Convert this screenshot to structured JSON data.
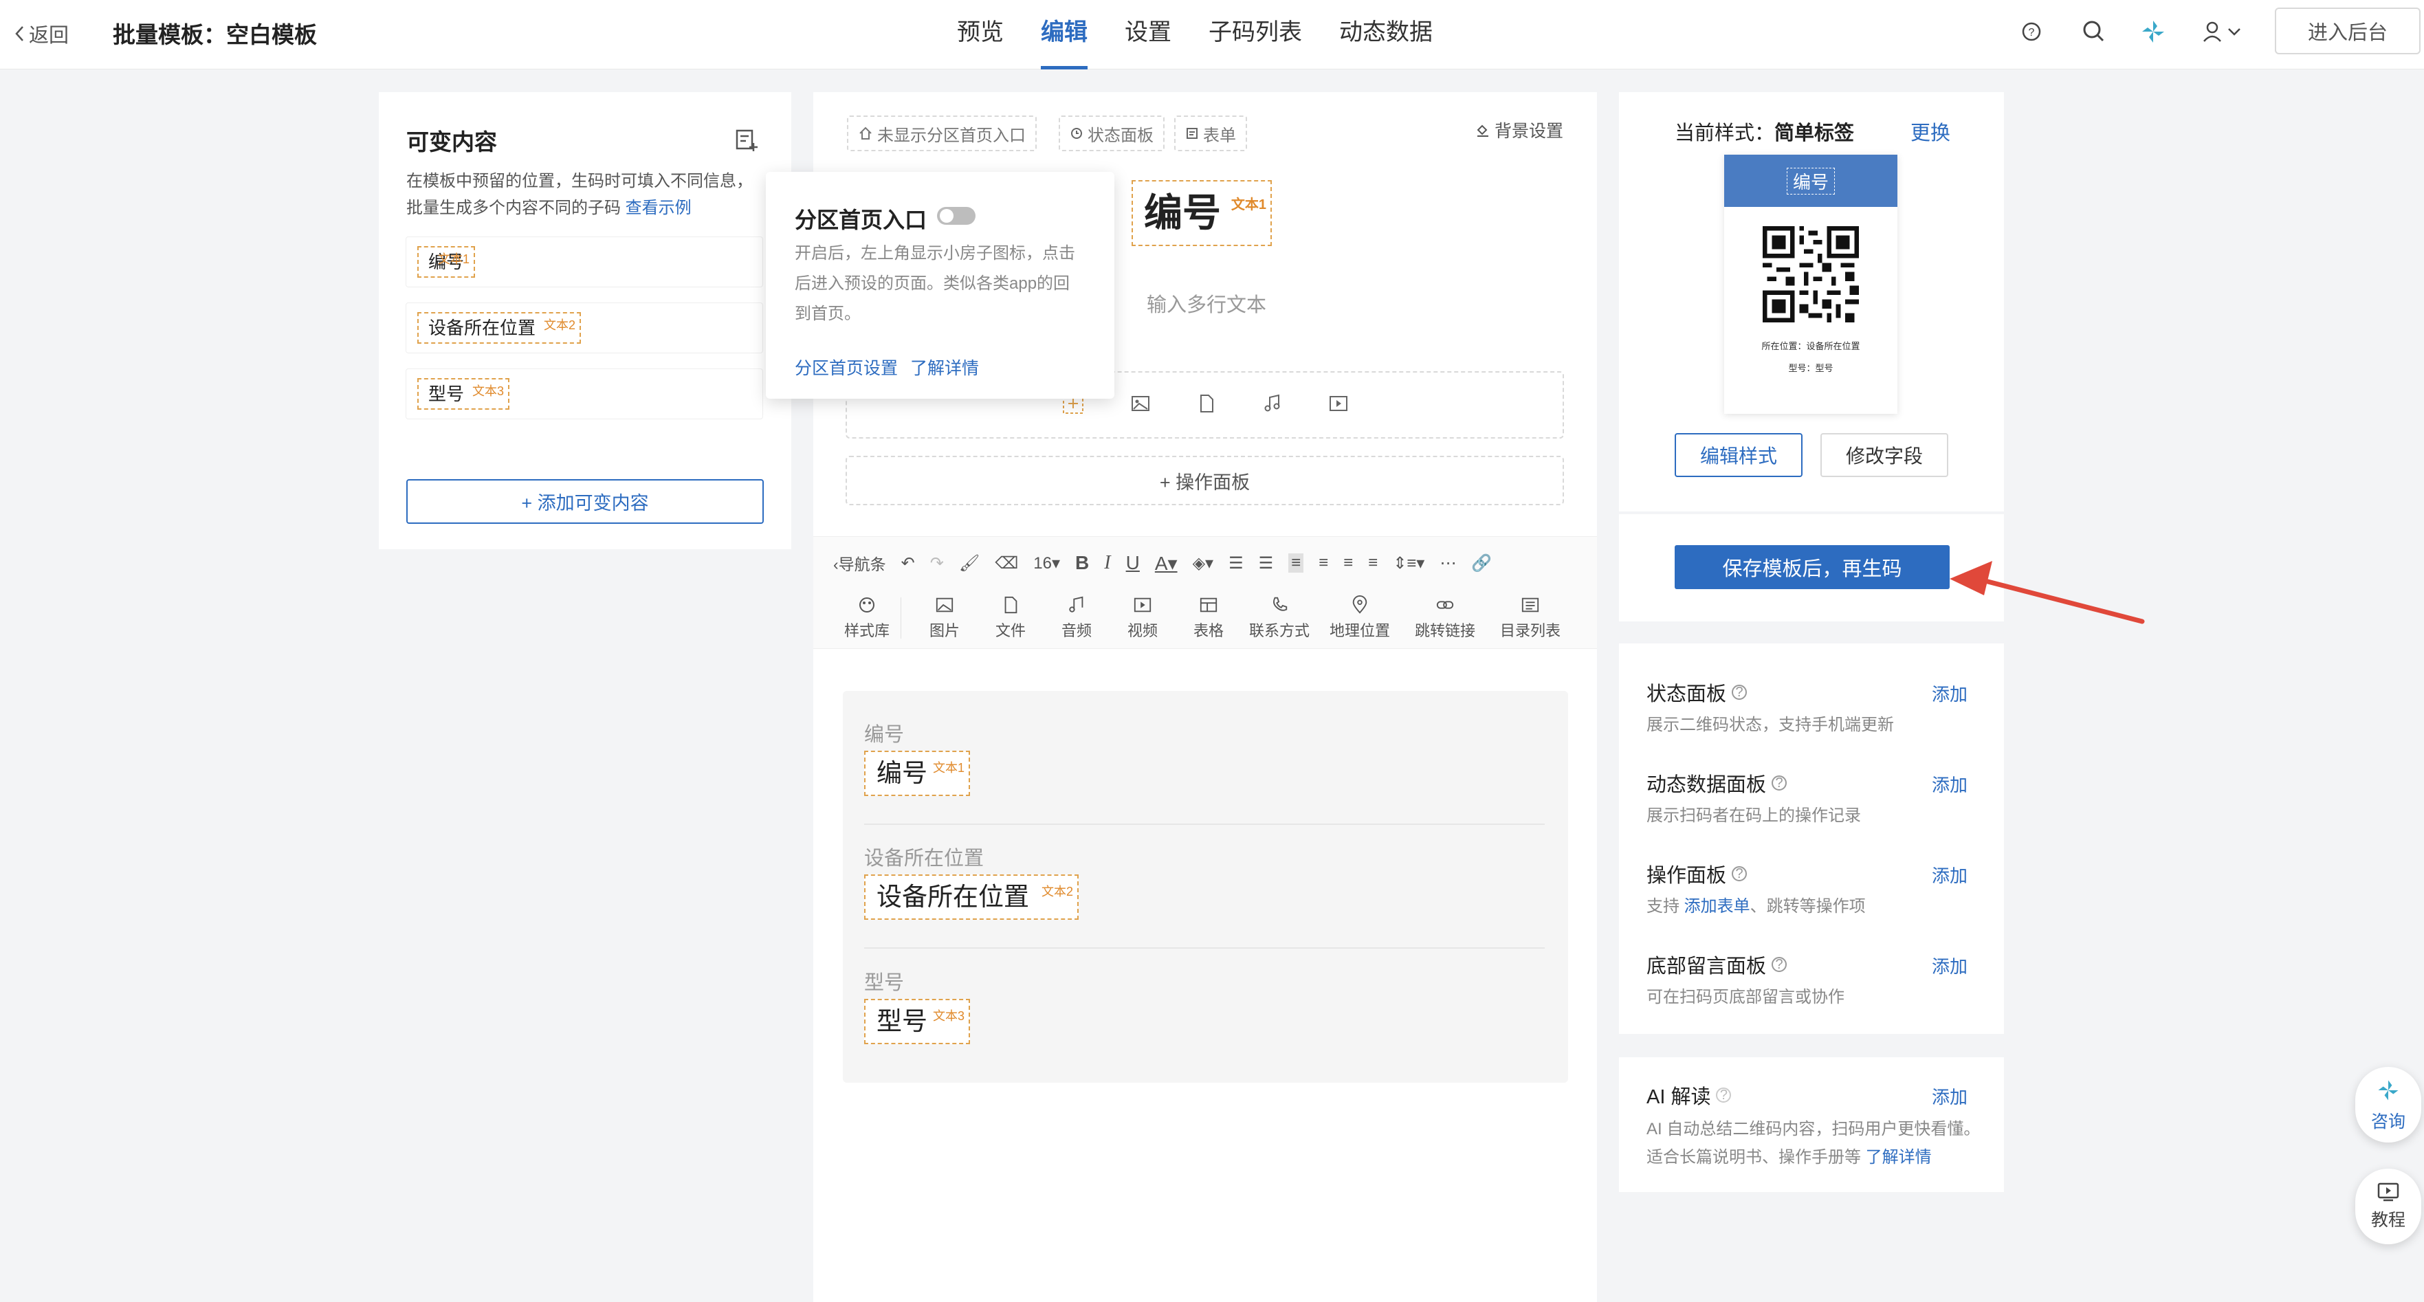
{
  "header": {
    "back_label": "返回",
    "title": "批量模板：空白模板",
    "tabs": [
      {
        "label": "预览"
      },
      {
        "label": "编辑"
      },
      {
        "label": "设置"
      },
      {
        "label": "子码列表"
      },
      {
        "label": "动态数据"
      }
    ],
    "active_tab": "编辑",
    "enter_backend": "进入后台"
  },
  "left_panel": {
    "title": "可变内容",
    "desc": "在模板中预留的位置，生码时可填入不同信息，批量生成多个内容不同的子码",
    "example_link": "查看示例",
    "items": [
      {
        "label": "编号",
        "tag": "文本1"
      },
      {
        "label": "设备所在位置",
        "tag": "文本2"
      },
      {
        "label": "型号",
        "tag": "文本3"
      }
    ],
    "add_button": "+ 添加可变内容"
  },
  "editor": {
    "home_entry_chip": "未显示分区首页入口",
    "status_panel_chip": "状态面板",
    "form_chip": "表单",
    "bg_settings": "背景设置",
    "heading_tag": {
      "label": "编号",
      "tag": "文本1"
    },
    "multiline_placeholder": "输入多行文本",
    "ops_panel": "+ 操作面板",
    "toolbar": {
      "nav_label": "导航条",
      "font_size": "16",
      "style_lib": "样式库",
      "inserts": [
        "图片",
        "文件",
        "音频",
        "视频",
        "表格",
        "联系方式",
        "地理位置",
        "跳转链接",
        "目录列表"
      ]
    },
    "fields": [
      {
        "label": "编号",
        "value": "编号",
        "tag": "文本1"
      },
      {
        "label": "设备所在位置",
        "value": "设备所在位置",
        "tag": "文本2"
      },
      {
        "label": "型号",
        "value": "型号",
        "tag": "文本3"
      }
    ]
  },
  "popover": {
    "title": "分区首页入口",
    "desc": "开启后，左上角显示小房子图标，点击后进入预设的页面。类似各类app的回到首页。",
    "link1": "分区首页设置",
    "link2": "了解详情",
    "toggle_on": false
  },
  "right_panel": {
    "style_prefix": "当前样式：",
    "style_name": "简单标签",
    "change": "更换",
    "preview_header": "编号",
    "preview_line1": "所在位置：设备所在位置",
    "preview_line2": "型号：型号",
    "edit_style": "编辑样式",
    "modify_fields": "修改字段",
    "save_button": "保存模板后，再生码",
    "features": [
      {
        "title": "状态面板",
        "desc": "展示二维码状态，支持手机端更新",
        "add": "添加"
      },
      {
        "title": "动态数据面板",
        "desc": "展示扫码者在码上的操作记录",
        "add": "添加"
      },
      {
        "title": "操作面板",
        "desc_prefix": "支持 ",
        "desc_link": "添加表单",
        "desc_suffix": "、跳转等操作项",
        "add": "添加"
      },
      {
        "title": "底部留言面板",
        "desc": "可在扫码页底部留言或协作",
        "add": "添加"
      }
    ],
    "ai": {
      "title": "AI 解读",
      "add": "添加",
      "desc": "AI 自动总结二维码内容，扫码用户更快看懂。适合长篇说明书、操作手册等",
      "link": "了解详情"
    }
  },
  "float": {
    "consult": "咨询",
    "tutorial": "教程"
  },
  "colors": {
    "primary": "#2d6cc0",
    "tag_border": "#e0a24c",
    "arrow": "#e0483a"
  }
}
